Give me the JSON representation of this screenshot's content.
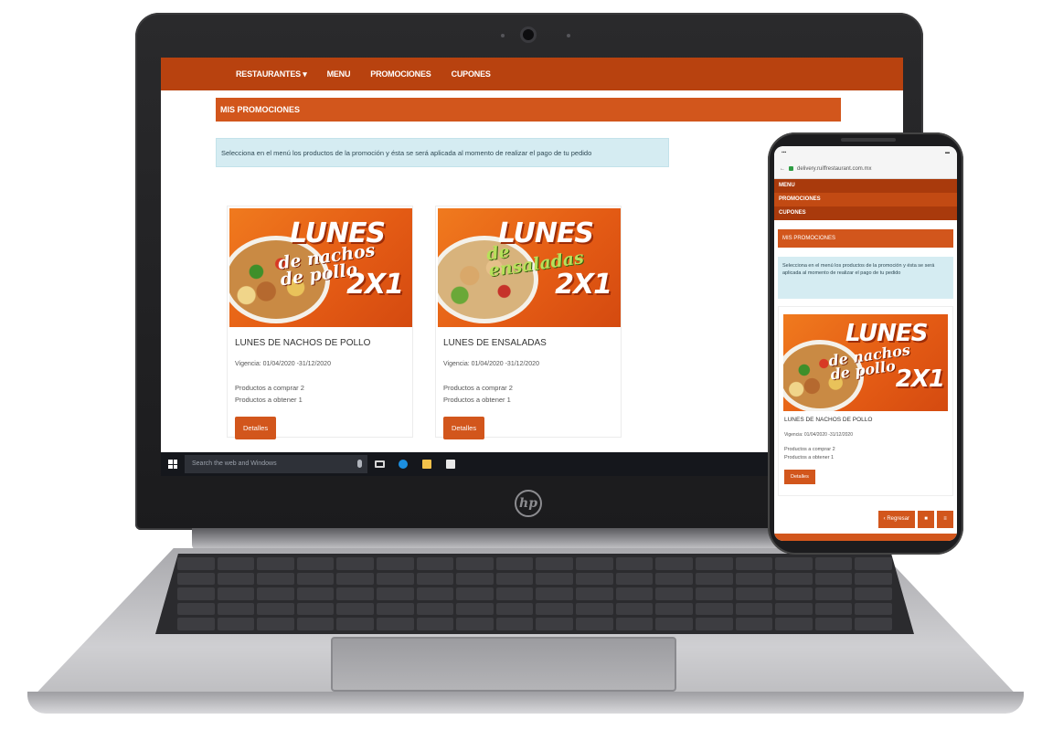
{
  "nav": {
    "items": [
      "RESTAURANTES ▾",
      "MENU",
      "PROMOCIONES",
      "CUPONES"
    ]
  },
  "page": {
    "title": "MIS PROMOCIONES",
    "alert": "Selecciona en el menú los productos de la promoción y ésta se será aplicada al momento de realizar el pago de tu pedido"
  },
  "cards": [
    {
      "banner_word": "LUNES",
      "banner_script": "de nachos de pollo",
      "banner_offer": "2X1",
      "name": "LUNES DE NACHOS DE POLLO",
      "validity": "Vigencia: 01/04/2020 -31/12/2020",
      "buy": "Productos a comprar 2",
      "get": "Productos a obtener 1",
      "button": "Detalles"
    },
    {
      "banner_word": "LUNES",
      "banner_script": "de ensaladas",
      "banner_offer": "2X1",
      "name": "LUNES DE ENSALADAS",
      "validity": "Vigencia: 01/04/2020 -31/12/2020",
      "buy": "Productos a comprar 2",
      "get": "Productos a obtener 1",
      "button": "Detalles"
    }
  ],
  "taskbar": {
    "search_placeholder": "Search the web and Windows"
  },
  "phone": {
    "url": "delivery.ruiffrestaurant.com.mx",
    "menu": [
      "MENU",
      "PROMOCIONES",
      "CUPONES"
    ],
    "title": "MIS PROMOCIONES",
    "alert": "Selecciona en el menú los productos de la promoción y ésta se será aplicada al momento de realizar el pago de tu pedido",
    "card": {
      "banner_word": "LUNES",
      "banner_script": "de nachos de pollo",
      "banner_offer": "2X1",
      "name": "LUNES DE NACHOS DE POLLO",
      "validity": "Vigencia: 01/04/2020 -31/12/2020",
      "buy": "Productos a comprar 2",
      "get": "Productos a obtener 1",
      "button": "Detalles"
    },
    "back_button": "‹ Regresar"
  },
  "device": {
    "laptop_logo": "hp"
  },
  "colors": {
    "nav": "#b8420f",
    "accent": "#d2561c",
    "alert_bg": "#d5ecf2"
  }
}
